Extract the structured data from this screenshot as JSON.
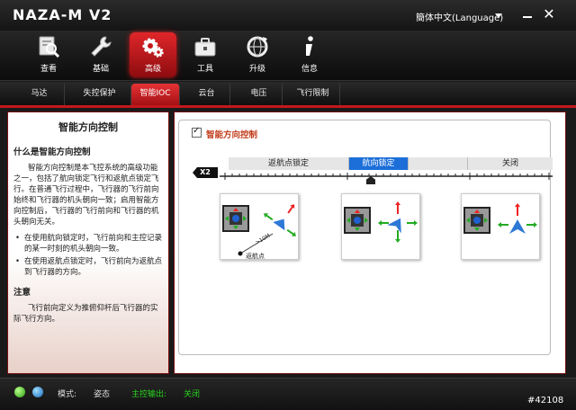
{
  "app": {
    "title": "NAZA-M V2",
    "language": "簡体中文(Language)",
    "minimize_icon": "minimize-icon",
    "close_icon": "close-icon",
    "close_glyph": "✕"
  },
  "toolbar": {
    "items": [
      {
        "label": "查看",
        "icon": "magnifier-icon",
        "active": false
      },
      {
        "label": "基础",
        "icon": "wrench-icon",
        "active": false
      },
      {
        "label": "高级",
        "icon": "gears-icon",
        "active": true
      },
      {
        "label": "工具",
        "icon": "toolbox-icon",
        "active": false
      },
      {
        "label": "升级",
        "icon": "upgrade-globe-icon",
        "active": false
      },
      {
        "label": "信息",
        "icon": "info-icon",
        "active": false
      }
    ]
  },
  "tabs": [
    {
      "label": "马达",
      "active": false
    },
    {
      "label": "失控保护",
      "active": false
    },
    {
      "label": "智能IOC",
      "active": true
    },
    {
      "label": "云台",
      "active": false
    },
    {
      "label": "电压",
      "active": false
    },
    {
      "label": "飞行限制",
      "active": false
    }
  ],
  "help": {
    "title": "智能方向控制",
    "q1": "什么是智能方向控制",
    "p1": "智能方向控制是本飞控系统的高级功能之一，包括了航向锁定飞行和返航点锁定飞行。在普通飞行过程中，飞行器的飞行前向始终和飞行器的机头朝向一致；启用智能方向控制后，飞行器的飞行前向和飞行器的机头朝向无关。",
    "bullets": [
      "在使用航向锁定时，飞行前向和主控记录的某一时刻的机头朝向一致。",
      "在使用返航点锁定时，飞行前向为返航点到飞行器的方向。"
    ],
    "note_title": "注意",
    "note": "飞行前向定义为推俯仰杆后飞行器的实际飞行方向。"
  },
  "settings": {
    "checkbox_label": "智能方向控制",
    "checked": true,
    "channel": "X2",
    "modes": [
      {
        "label": "返航点锁定",
        "active": false
      },
      {
        "label": "航向锁定",
        "active": true
      },
      {
        "label": "关闭",
        "active": false
      }
    ],
    "diagram_distance": ">10M",
    "diagram_home_label": "返航点"
  },
  "status": {
    "mode_label": "模式:",
    "mode_value": "姿态",
    "output_label": "主控输出:",
    "output_value": "关闭"
  },
  "colors": {
    "accent_red": "#c4181c",
    "active_mode_blue": "#1c6fd9",
    "status_green": "#28d41e",
    "section_title": "#c03c1a"
  },
  "watermark": "#42108"
}
